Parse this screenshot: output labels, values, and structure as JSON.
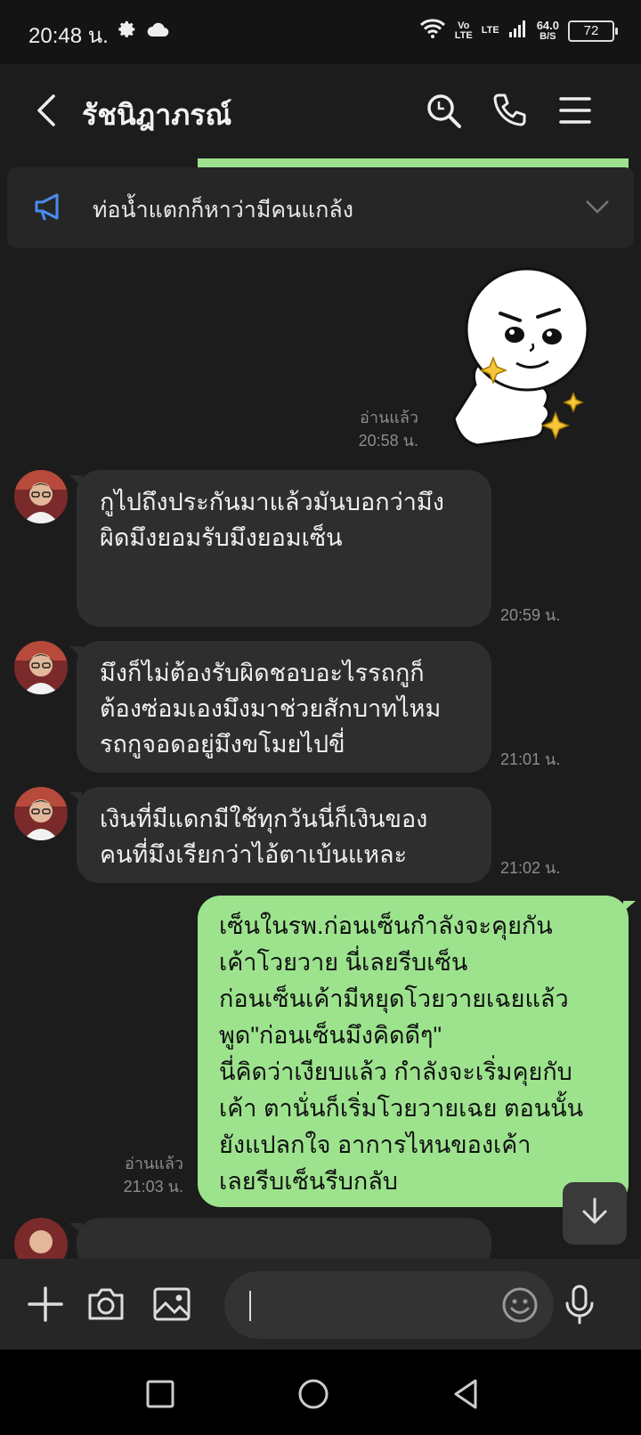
{
  "status_bar": {
    "time": "20:48 น.",
    "volte": [
      "Vo",
      "LTE"
    ],
    "lte": "LTE",
    "speed": [
      "64.0",
      "B/S"
    ],
    "battery": "72"
  },
  "header": {
    "title": "รัชนิฎาภรณ์"
  },
  "announcement": {
    "text": "ท่อน้ำแตกก็หาว่ามีคนแกล้ง"
  },
  "messages": {
    "sticker_read": "อ่านแล้ว",
    "sticker_time": "20:58 น.",
    "m1": {
      "lines": [
        "กูไปถึงประกันมาแล้วมันบอกว่ามึง",
        "ผิดมึงยอมรับมึงยอมเซ็น"
      ],
      "time": "20:59 น."
    },
    "m2": {
      "lines": [
        "มึงก็ไม่ต้องรับผิดชอบอะไรรถกูก็",
        "ต้องซ่อมเองมึงมาช่วยสักบาทไหม",
        "รถกูจอดอยู่มึงขโมยไปขี่"
      ],
      "time": "21:01 น."
    },
    "m3": {
      "lines": [
        "เงินที่มีแดกมีใช้ทุกวันนี่ก็เงินของ",
        "คนที่มึงเรียกว่าไอ้ตาเบ้นแหละ"
      ],
      "time": "21:02 น."
    },
    "m4": {
      "lines": [
        "เซ็นในรพ.ก่อนเซ็นกำลังจะคุยกัน",
        "เค้าโวยวาย นี่เลยรีบเซ็น",
        "ก่อนเซ็นเค้ามีหยุดโวยวายเฉยแล้ว",
        "พูด\"ก่อนเซ็นมึงคิดดีๆ\"",
        "นี่คิดว่าเงียบแล้ว กำลังจะเริ่มคุยกับ",
        "เค้า ตานั่นก็เริ่มโวยวายเฉย ตอนนั้น",
        "ยังแปลกใจ อาการไหนของเค้า",
        "เลยรีบเซ็นรีบกลับ"
      ],
      "read": "อ่านแล้ว",
      "time": "21:03 น."
    }
  },
  "colors": {
    "outgoing_bubble": "#9de38e",
    "incoming_bubble": "#2e2e2e",
    "background": "#1c1c1c"
  },
  "icons": [
    "settings-icon",
    "cloud-icon",
    "wifi-icon",
    "signal-icon",
    "battery-icon",
    "back-icon",
    "search-icon",
    "phone-icon",
    "menu-icon",
    "megaphone-icon",
    "chevron-down-icon",
    "arrow-down-icon",
    "plus-icon",
    "camera-icon",
    "image-icon",
    "emoji-icon",
    "mic-icon"
  ]
}
